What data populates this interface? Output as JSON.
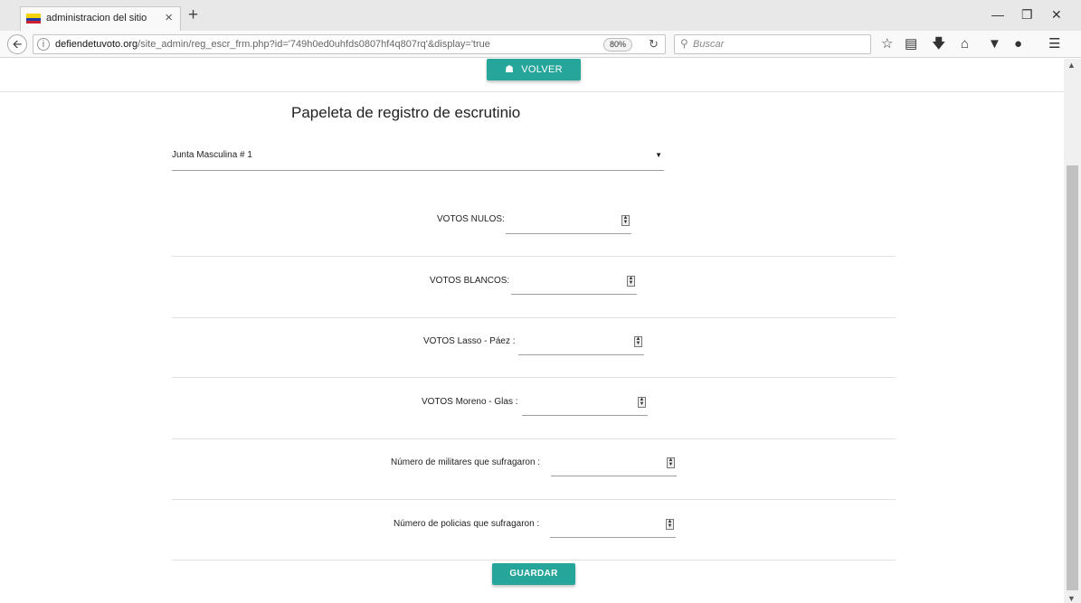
{
  "browser": {
    "tab_title": "administracion del sitio",
    "tab_close": "×",
    "new_tab": "+",
    "url_domain": "defiendetuvoto.org",
    "url_path": "/site_admin/reg_escr_frm.php?id='749h0ed0uhfds0807hf4q807rq'&display='true",
    "zoom": "80%",
    "search_placeholder": "Buscar",
    "flag_colors": [
      "#f4d20a",
      "#1f3ea8",
      "#d0202e"
    ]
  },
  "page": {
    "volver_label": "VOLVER",
    "title": "Papeleta de registro de escrutinio",
    "junta_select": {
      "selected": "Junta Masculina # 1"
    },
    "fields": [
      {
        "label": "VOTOS NULOS:",
        "value": ""
      },
      {
        "label": "VOTOS BLANCOS:",
        "value": ""
      },
      {
        "label": "VOTOS Lasso - Páez :",
        "value": ""
      },
      {
        "label": "VOTOS Moreno - Glas :",
        "value": ""
      },
      {
        "label": "Número de militares que sufragaron :",
        "value": ""
      },
      {
        "label": "Número de policias que sufragaron :",
        "value": ""
      }
    ],
    "guardar_label": "GUARDAR",
    "accent_color": "#26a69a"
  }
}
